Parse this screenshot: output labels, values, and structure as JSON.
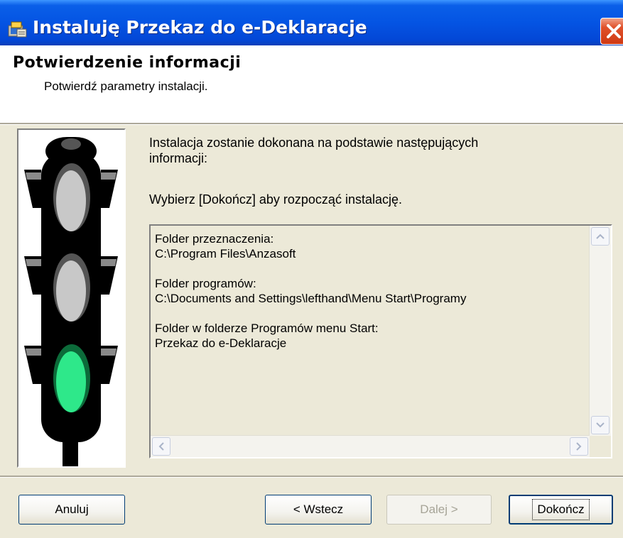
{
  "window": {
    "title": "Instaluję Przekaz do e-Deklaracje",
    "icon": "installer-icon",
    "close_icon": "close-icon"
  },
  "header": {
    "title": "Potwierdzenie informacji",
    "subtitle": "Potwierdź parametry instalacji."
  },
  "body": {
    "intro_line1": "Instalacja zostanie dokonana na podstawie następujących",
    "intro_line2": "informacji:",
    "instruction": "Wybierz [Dokończ] aby rozpocząć instalację.",
    "image": "traffic-light-green"
  },
  "summary": {
    "dest_label": "Folder przeznaczenia:",
    "dest_value": "C:\\Program Files\\Anzasoft",
    "programs_label": "Folder programów:",
    "programs_value": "C:\\Documents and Settings\\lefthand\\Menu Start\\Programy",
    "start_label": "Folder w folderze Programów menu Start:",
    "start_value": "Przekaz do e-Deklaracje"
  },
  "buttons": {
    "cancel": "Anuluj",
    "back": "< Wstecz",
    "next": "Dalej >",
    "finish": "Dokończ"
  },
  "colors": {
    "titlebar": "#0454e3",
    "dialog_bg": "#ece9d8",
    "green_light": "#2ee88a",
    "close_button": "#e0512b"
  }
}
